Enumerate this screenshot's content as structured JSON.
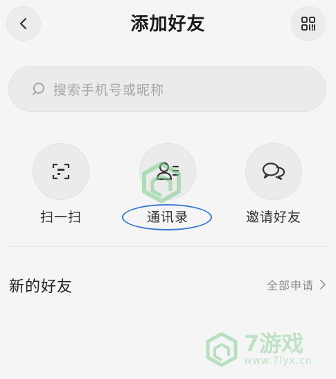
{
  "header": {
    "title": "添加好友"
  },
  "search": {
    "placeholder": "搜索手机号或昵称"
  },
  "actions": [
    {
      "label": "扫一扫",
      "icon": "scan-icon"
    },
    {
      "label": "通讯录",
      "icon": "contacts-icon"
    },
    {
      "label": "邀请好友",
      "icon": "chat-bubbles-icon"
    }
  ],
  "new_friends": {
    "title": "新的好友",
    "all_requests": "全部申请"
  },
  "watermark": {
    "brand": "7游戏",
    "url": "www.7lyx.cn"
  },
  "colors": {
    "background": "#f5f5f5",
    "annotation_ellipse": "#3a78d2",
    "watermark": "#9cd6a8"
  }
}
